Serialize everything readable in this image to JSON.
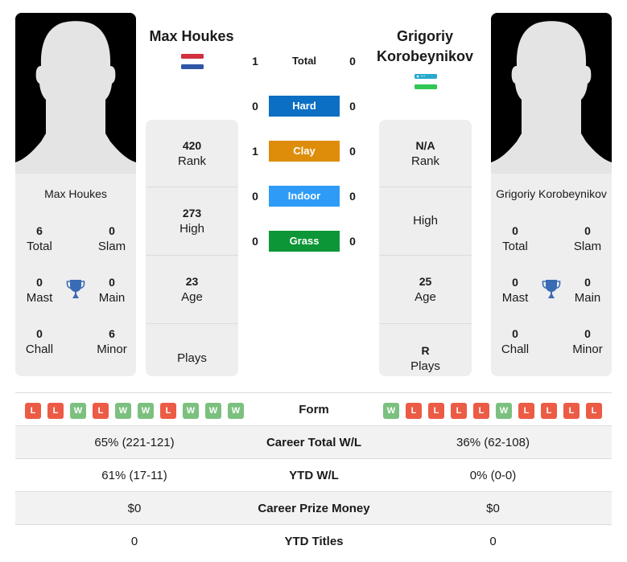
{
  "player_left": {
    "name": "Max Houkes",
    "country_flag": "netherlands-flag",
    "titles": {
      "total": {
        "value": "6",
        "label": "Total"
      },
      "slam": {
        "value": "0",
        "label": "Slam"
      },
      "mast": {
        "value": "0",
        "label": "Mast"
      },
      "main": {
        "value": "0",
        "label": "Main"
      },
      "chall": {
        "value": "0",
        "label": "Chall"
      },
      "minor": {
        "value": "6",
        "label": "Minor"
      }
    },
    "info": {
      "rank": {
        "value": "420",
        "label": "Rank"
      },
      "high": {
        "value": "273",
        "label": "High"
      },
      "age": {
        "value": "23",
        "label": "Age"
      },
      "plays": {
        "value": "",
        "label": "Plays"
      }
    },
    "form": [
      "L",
      "L",
      "W",
      "L",
      "W",
      "W",
      "L",
      "W",
      "W",
      "W"
    ]
  },
  "player_right": {
    "name": "Grigoriy Korobeynikov",
    "country_flag": "uzbekistan-flag",
    "titles": {
      "total": {
        "value": "0",
        "label": "Total"
      },
      "slam": {
        "value": "0",
        "label": "Slam"
      },
      "mast": {
        "value": "0",
        "label": "Mast"
      },
      "main": {
        "value": "0",
        "label": "Main"
      },
      "chall": {
        "value": "0",
        "label": "Chall"
      },
      "minor": {
        "value": "0",
        "label": "Minor"
      }
    },
    "info": {
      "rank": {
        "value": "N/A",
        "label": "Rank"
      },
      "high": {
        "value": "",
        "label": "High"
      },
      "age": {
        "value": "25",
        "label": "Age"
      },
      "plays": {
        "value": "R",
        "label": "Plays"
      }
    },
    "form": [
      "W",
      "L",
      "L",
      "L",
      "L",
      "W",
      "L",
      "L",
      "L",
      "L"
    ]
  },
  "h2h": [
    {
      "label": "Total",
      "left": "1",
      "right": "0",
      "color": ""
    },
    {
      "label": "Hard",
      "left": "0",
      "right": "0",
      "color": "#0b6fc4"
    },
    {
      "label": "Clay",
      "left": "1",
      "right": "0",
      "color": "#de8d0b"
    },
    {
      "label": "Indoor",
      "left": "0",
      "right": "0",
      "color": "#2e9cf7"
    },
    {
      "label": "Grass",
      "left": "0",
      "right": "0",
      "color": "#0d9637"
    }
  ],
  "stats": {
    "form_label": "Form",
    "rows": [
      {
        "label": "Career Total W/L",
        "left": "65% (221-121)",
        "right": "36% (62-108)"
      },
      {
        "label": "YTD W/L",
        "left": "61% (17-11)",
        "right": "0% (0-0)"
      },
      {
        "label": "Career Prize Money",
        "left": "$0",
        "right": "$0"
      },
      {
        "label": "YTD Titles",
        "left": "0",
        "right": "0"
      }
    ]
  },
  "colors": {
    "win": "#7cc07f",
    "loss": "#ec5b45",
    "trophy": "#3a6bb5"
  }
}
